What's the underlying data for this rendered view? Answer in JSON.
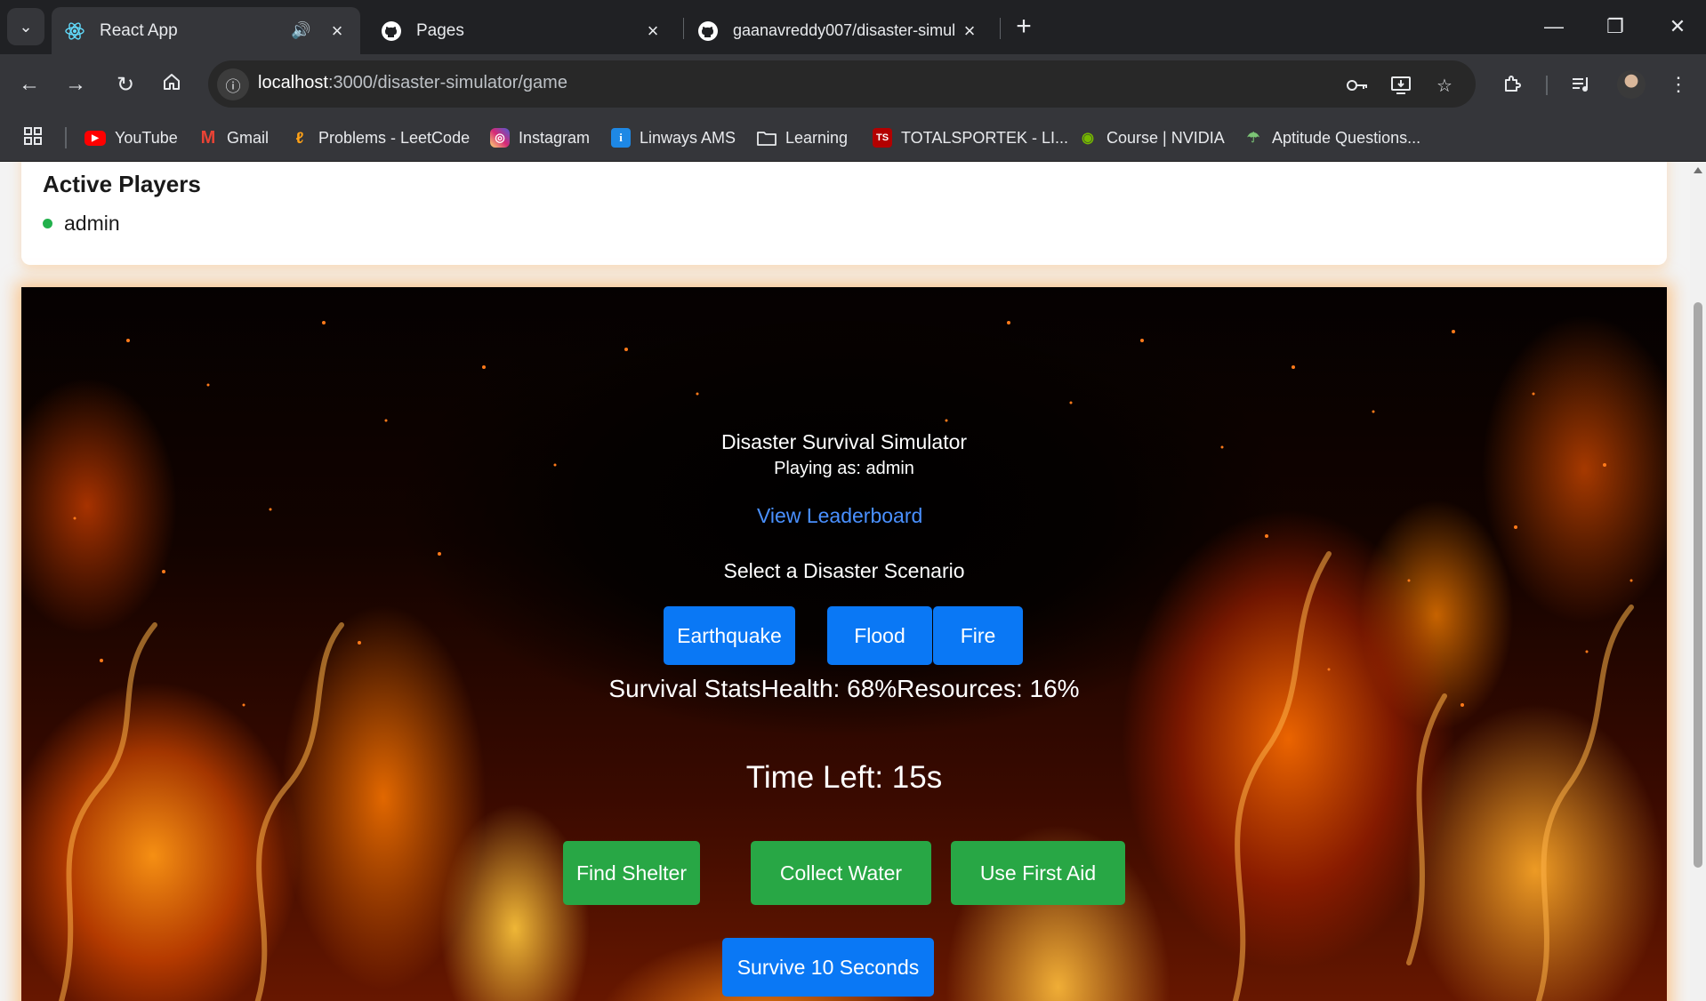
{
  "browser": {
    "tabs": [
      {
        "title": "React App",
        "icon": "react-icon"
      },
      {
        "title": "Pages",
        "icon": "github-icon"
      },
      {
        "title": "gaanavreddy007/disaster-simul",
        "icon": "github-icon"
      }
    ],
    "url_host": "localhost",
    "url_path": ":3000/disaster-simulator/game",
    "bookmarks": [
      {
        "label": "YouTube",
        "icon": "youtube-icon"
      },
      {
        "label": "Gmail",
        "icon": "gmail-icon"
      },
      {
        "label": "Problems - LeetCode",
        "icon": "leetcode-icon"
      },
      {
        "label": "Instagram",
        "icon": "instagram-icon"
      },
      {
        "label": "Linways AMS",
        "icon": "linways-icon"
      },
      {
        "label": "Learning",
        "icon": "folder-icon"
      },
      {
        "label": "TOTALSPORTEK - LI...",
        "icon": "totalsportek-icon"
      },
      {
        "label": "Course | NVIDIA",
        "icon": "nvidia-icon"
      },
      {
        "label": "Aptitude Questions...",
        "icon": "aptitude-icon"
      }
    ]
  },
  "players": {
    "title": "Active Players",
    "list": [
      {
        "name": "admin",
        "status_color": "#22b14c"
      }
    ]
  },
  "game": {
    "title": "Disaster Survival Simulator",
    "playing_as": "Playing as: admin",
    "leaderboard_link": "View Leaderboard",
    "select_label": "Select a Disaster Scenario",
    "scenarios": [
      "Earthquake",
      "Flood",
      "Fire"
    ],
    "stats_text": "Survival StatsHealth: 68%Resources: 16%",
    "timer_text": "Time Left: 15s",
    "actions": [
      "Find Shelter",
      "Collect Water",
      "Use First Aid"
    ],
    "survive_button": "Survive 10 Seconds"
  },
  "colors": {
    "primary_blue": "#0a78f5",
    "action_green": "#28a745",
    "link_blue": "#4a90ff"
  }
}
